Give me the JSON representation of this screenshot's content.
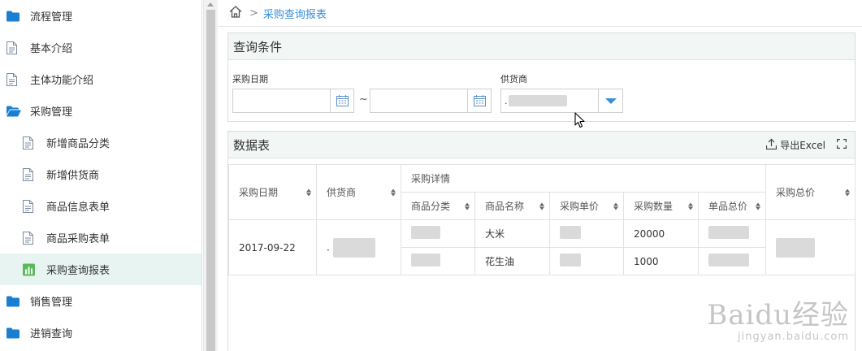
{
  "sidebar": {
    "items": [
      {
        "label": "流程管理",
        "level": 1,
        "icon": "folder-icon"
      },
      {
        "label": "基本介绍",
        "level": 1,
        "icon": "document-icon"
      },
      {
        "label": "主体功能介绍",
        "level": 1,
        "icon": "document-icon"
      },
      {
        "label": "采购管理",
        "level": 1,
        "icon": "folder-open-icon"
      },
      {
        "label": "新增商品分类",
        "level": 2,
        "icon": "document-icon"
      },
      {
        "label": "新增供货商",
        "level": 2,
        "icon": "document-icon"
      },
      {
        "label": "商品信息表单",
        "level": 2,
        "icon": "document-icon"
      },
      {
        "label": "商品采购表单",
        "level": 2,
        "icon": "document-icon"
      },
      {
        "label": "采购查询报表",
        "level": 2,
        "icon": "bar-chart-icon",
        "active": true
      },
      {
        "label": "销售管理",
        "level": 1,
        "icon": "folder-icon"
      },
      {
        "label": "进销查询",
        "level": 1,
        "icon": "folder-icon"
      }
    ]
  },
  "breadcrumb": {
    "current": "采购查询报表"
  },
  "query": {
    "title": "查询条件",
    "date_label": "采购日期",
    "separator": "~",
    "supplier_label": "供货商",
    "supplier_value_prefix": "."
  },
  "data_table": {
    "title": "数据表",
    "export_label": "导出Excel",
    "headers": {
      "date": "采购日期",
      "supplier": "供货商",
      "details": "采购详情",
      "category": "商品分类",
      "name": "商品名称",
      "unit_price": "采购单价",
      "quantity": "采购数量",
      "item_total": "单品总价",
      "total": "采购总价"
    },
    "record": {
      "date": "2017-09-22",
      "supplier_prefix": ".",
      "rows": [
        {
          "name": "大米",
          "quantity": "20000"
        },
        {
          "name": "花生油",
          "quantity": "1000"
        }
      ]
    }
  },
  "watermark": {
    "logo": "Baidu经验",
    "url": "jingyan.baidu.com"
  },
  "colors": {
    "accent": "#3a8fd9",
    "folder": "#1a7fd0",
    "active_bg": "#e8f4f1",
    "chart_icon": "#5cb85c"
  }
}
